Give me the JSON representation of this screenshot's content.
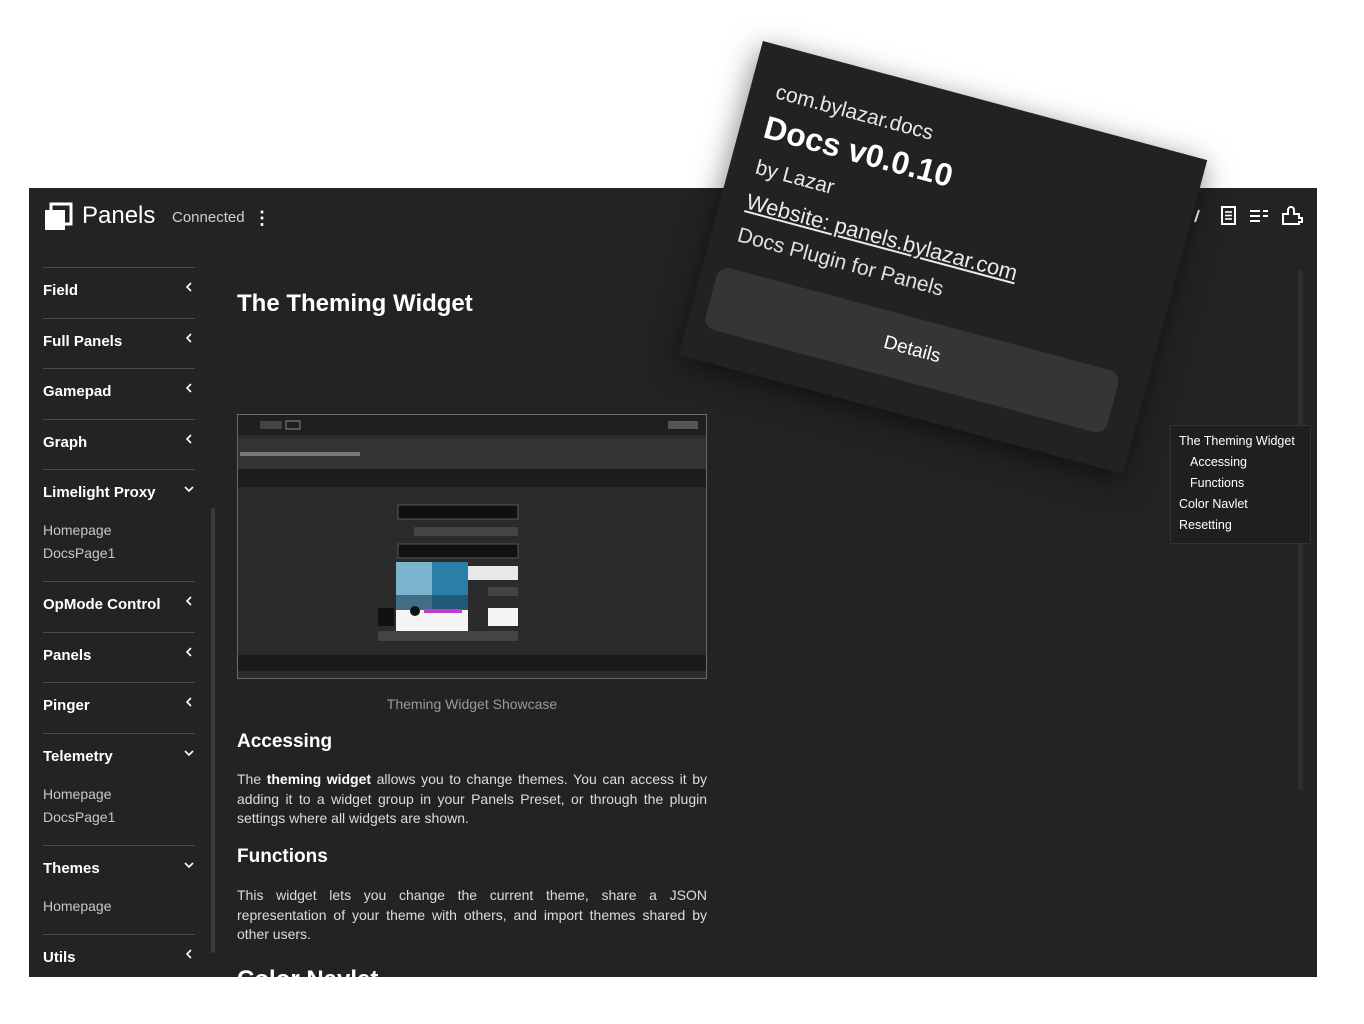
{
  "header": {
    "app_title": "Panels",
    "status": "Connected",
    "menu_glyph": "⋮"
  },
  "sidebar": {
    "groups": [
      {
        "label": "Field",
        "expanded": false,
        "items": []
      },
      {
        "label": "Full Panels",
        "expanded": false,
        "items": []
      },
      {
        "label": "Gamepad",
        "expanded": false,
        "items": []
      },
      {
        "label": "Graph",
        "expanded": false,
        "items": []
      },
      {
        "label": "Limelight Proxy",
        "expanded": true,
        "items": [
          "Homepage",
          "DocsPage1"
        ]
      },
      {
        "label": "OpMode Control",
        "expanded": false,
        "items": []
      },
      {
        "label": "Panels",
        "expanded": false,
        "items": []
      },
      {
        "label": "Pinger",
        "expanded": false,
        "items": []
      },
      {
        "label": "Telemetry",
        "expanded": true,
        "items": [
          "Homepage",
          "DocsPage1"
        ]
      },
      {
        "label": "Themes",
        "expanded": true,
        "items": [
          "Homepage"
        ]
      },
      {
        "label": "Utils",
        "expanded": false,
        "items": []
      }
    ]
  },
  "doc": {
    "title": "The Theming Widget",
    "caption": "Theming Widget Showcase",
    "accessing": {
      "heading": "Accessing",
      "pre": "The ",
      "bold": "theming widget",
      "post": " allows you to change themes. You can access it by adding it to a widget group in your Panels Preset, or through the plugin settings where all widgets are shown."
    },
    "functions": {
      "heading": "Functions",
      "text": "This widget lets you change the current theme, share a JSON representation of your theme with others, and import themes shared by other users."
    },
    "color_navlet": {
      "heading": "Color Navlet"
    }
  },
  "toc": [
    "The Theming Widget",
    "Accessing",
    "Functions",
    "Color Navlet",
    "Resetting"
  ],
  "plugin_popup": {
    "id": "com.bylazar.docs",
    "name": "Docs v0.0.10",
    "author": "by Lazar",
    "website": "Website: panels.bylazar.com",
    "description": "Docs Plugin for Panels",
    "button": "Details"
  },
  "colors": {
    "app_bg": "#232323",
    "popup_bg": "#222222",
    "button_bg": "#353535",
    "text": "#ffffff",
    "muted": "#9a9a9a"
  },
  "icons": [
    "panels-logo-icon",
    "kebab-menu-icon",
    "chevron-left-icon",
    "chevron-down-icon",
    "docs-icon",
    "list-icon",
    "plugin-icon"
  ]
}
